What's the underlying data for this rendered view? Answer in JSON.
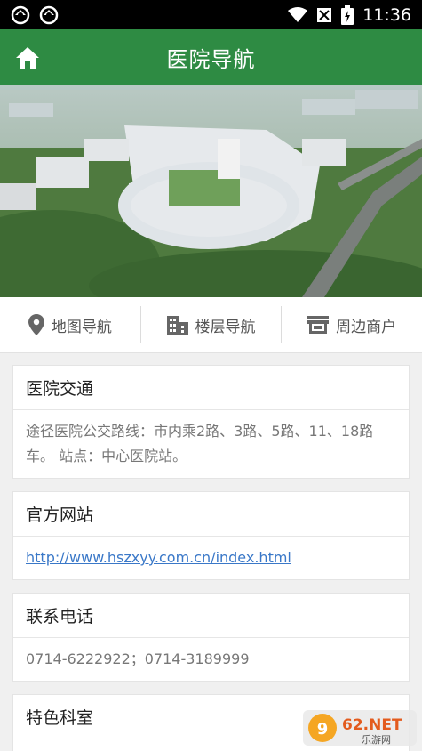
{
  "status": {
    "time": "11:36"
  },
  "header": {
    "title": "医院导航"
  },
  "nav": [
    {
      "label": "地图导航",
      "icon": "location-pin-icon"
    },
    {
      "label": "楼层导航",
      "icon": "building-icon"
    },
    {
      "label": "周边商户",
      "icon": "store-icon"
    }
  ],
  "sections": {
    "traffic": {
      "title": "医院交通",
      "body": "途径医院公交路线：市内乘2路、3路、5路、11、18路车。 站点：中心医院站。"
    },
    "website": {
      "title": "官方网站",
      "link": "http://www.hszxyy.com.cn/index.html"
    },
    "phone": {
      "title": "联系电话",
      "body": "0714-6222922；0714-3189999"
    },
    "dept": {
      "title": "特色科室"
    }
  },
  "watermark": {
    "brand": "962.NET",
    "sub": "乐游网"
  },
  "colors": {
    "primary": "#2e8b43",
    "link": "#3a78c8"
  }
}
